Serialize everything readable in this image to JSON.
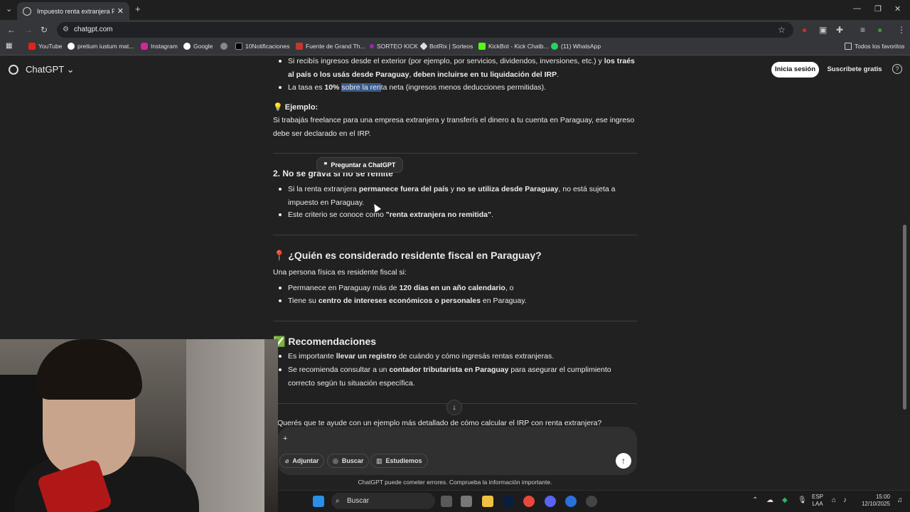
{
  "browser": {
    "tab_title": "Impuesto renta extranjera Para",
    "url": "chatgpt.com",
    "bookmarks": [
      {
        "label": "YouTube"
      },
      {
        "label": "pretium iustum mat..."
      },
      {
        "label": "Instagram"
      },
      {
        "label": "Google"
      },
      {
        "label": "10Notificaciones"
      },
      {
        "label": "Fuente de Grand Th..."
      },
      {
        "label": "SORTEO KICK"
      },
      {
        "label": "BotRix | Sorteos"
      },
      {
        "label": "KickBot - Kick Chatb..."
      },
      {
        "label": "(11) WhatsApp"
      }
    ],
    "all_bookmarks": "Todos los favoritos"
  },
  "header": {
    "brand": "ChatGPT",
    "brand_caret": "⌄",
    "login": "Inicia sesión",
    "signup": "Suscríbete gratis",
    "help": "?"
  },
  "content": {
    "b1_pre": "Si recibís ingresos desde el exterior (por ejemplo, por servicios, dividendos, inversiones, etc.) y ",
    "b1_bold": "los traés al país o los usás desde Paraguay",
    "b1_mid": ", ",
    "b1_bold2": "deben incluirse en tu liquidación del IRP",
    "b1_end": ".",
    "b2_pre": "La tasa es ",
    "b2_bold": "10%",
    "b2_sp": " ",
    "b2_hl": "sobre la ren",
    "b2_end": "ta neta (ingresos menos deducciones permitidas).",
    "example_icon": "💡",
    "example_title": "Ejemplo:",
    "example_text": "Si trabajás freelance para una empresa extranjera y transferís el dinero a tu cuenta en Paraguay, ese ingreso debe ser declarado en el IRP.",
    "popup": "Preguntar a ChatGPT",
    "popup_icon": "❞",
    "section2_title": "2. No se grava si no se remite",
    "s2b1_pre": "Si la renta extranjera ",
    "s2b1_bold": "permanece fuera del país",
    "s2b1_mid": " y ",
    "s2b1_bold2": "no se utiliza desde Paraguay",
    "s2b1_end": ", no está sujeta a impuesto en Paraguay.",
    "s2b2_pre": "Este criterio se conoce como ",
    "s2b2_bold": "\"renta extranjera no remitida\"",
    "s2b2_end": ".",
    "resident_icon": "📍",
    "resident_title": "¿Quién es considerado residente fiscal en Paraguay?",
    "resident_intro": "Una persona física es residente fiscal si:",
    "r1_pre": "Permanece en Paraguay más de ",
    "r1_bold": "120 días en un año calendario",
    "r1_end": ", o",
    "r2_pre": "Tiene su ",
    "r2_bold": "centro de intereses económicos o personales",
    "r2_end": " en Paraguay.",
    "rec_icon": "✅",
    "rec_title": "Recomendaciones",
    "rec1_pre": "Es importante ",
    "rec1_bold": "llevar un registro",
    "rec1_end": " de cuándo y cómo ingresás rentas extranjeras.",
    "rec2_pre": "Se recomienda consultar a un ",
    "rec2_bold": "contador tributarista en Paraguay",
    "rec2_end": " para asegurar el cumplimiento correcto según tu situación específica.",
    "suggestion": "Querés que te ayude con un ejemplo más detallado de cómo calcular el IRP con renta extranjera?"
  },
  "composer": {
    "plus": "+",
    "attach": "Adjuntar",
    "search": "Buscar",
    "study": "Estudiemos",
    "send_icon": "↑",
    "scroll_icon": "↓",
    "disclaimer": "ChatGPT puede cometer errores. Comprueba la información importante."
  },
  "taskbar": {
    "search": "Buscar",
    "lang1": "ESP",
    "lang2": "LAA",
    "time": "15:00",
    "date": "12/10/2025"
  },
  "colors": {
    "background": "#212121",
    "highlight": "#3a5a8a"
  }
}
